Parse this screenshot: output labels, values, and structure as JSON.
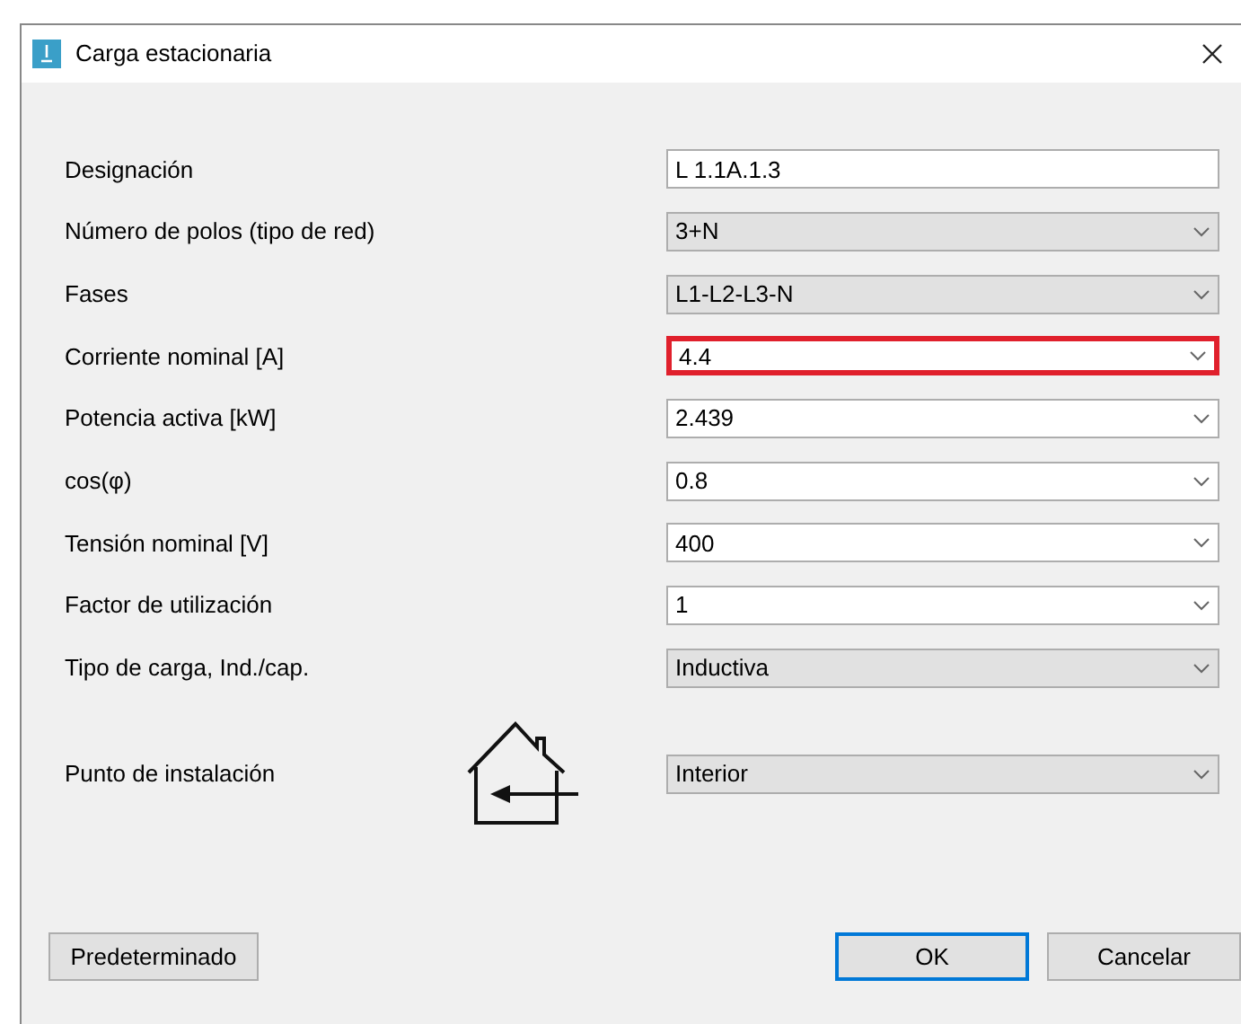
{
  "window": {
    "title": "Carga estacionaria"
  },
  "fields": [
    {
      "label": "Designación",
      "kind": "text",
      "value": "L 1.1A.1.3",
      "highlighted": false
    },
    {
      "label": "Número de polos (tipo de red)",
      "kind": "list",
      "value": "3+N",
      "highlighted": false
    },
    {
      "label": "Fases",
      "kind": "list",
      "value": "L1-L2-L3-N",
      "highlighted": false
    },
    {
      "label": "Corriente nominal [A]",
      "kind": "combo",
      "value": "4.4",
      "highlighted": true
    },
    {
      "label": "Potencia activa [kW]",
      "kind": "combo",
      "value": "2.439",
      "highlighted": false
    },
    {
      "label": "cos(φ)",
      "kind": "combo",
      "value": "0.8",
      "highlighted": false
    },
    {
      "label": "Tensión nominal [V]",
      "kind": "combo",
      "value": "400",
      "highlighted": false
    },
    {
      "label": "Factor de utilización",
      "kind": "combo",
      "value": "1",
      "highlighted": false
    },
    {
      "label": "Tipo de carga, Ind./cap.",
      "kind": "list",
      "value": "Inductiva",
      "highlighted": false
    }
  ],
  "installation": {
    "label": "Punto de instalación",
    "kind": "list",
    "value": "Interior"
  },
  "buttons": [
    {
      "label": "Predeterminado",
      "default": false
    },
    {
      "label": "OK",
      "default": true
    },
    {
      "label": "Cancelar",
      "default": false
    }
  ]
}
